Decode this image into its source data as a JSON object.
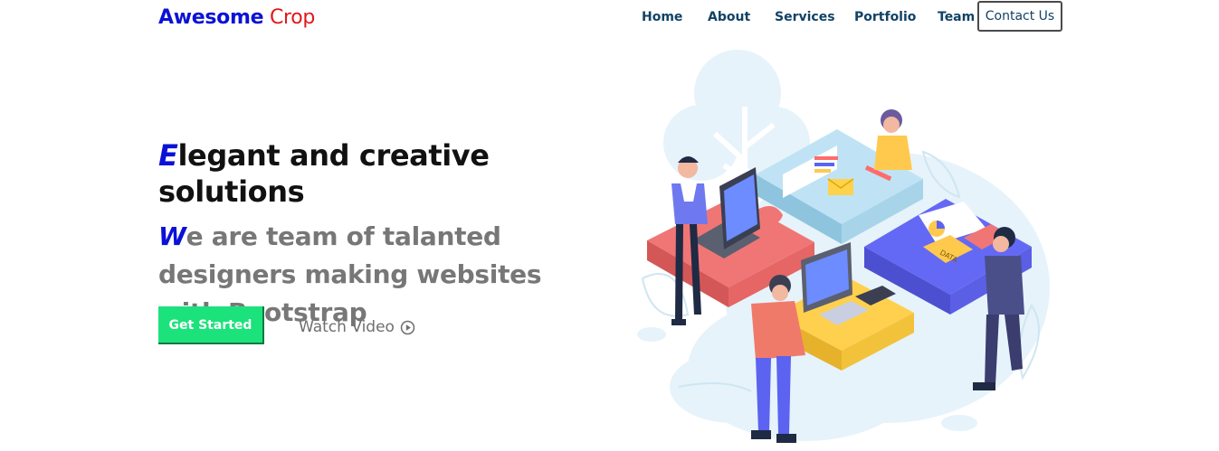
{
  "brand": {
    "part1": "Awesome",
    "part2": "Crop"
  },
  "nav": {
    "items": [
      "Home",
      "About",
      "Services",
      "Portfolio",
      "Team"
    ],
    "contact": "Contact Us"
  },
  "hero": {
    "title_cap": "E",
    "title_rest": "legant and creative solutions",
    "subtitle_cap": "W",
    "subtitle_rest": "e are team of talanted designers making websites with Bootstrap",
    "cta": "Get Started",
    "watch": "Watch Video"
  },
  "illustration": {
    "labels": [
      "DATA",
      "DATA"
    ],
    "icon": "teamwork-puzzle-illustration"
  },
  "colors": {
    "brand_blue": "#0b12d6",
    "brand_red": "#e3171a",
    "nav_text": "#124265",
    "cta_green": "#1ce27b",
    "subtitle_gray": "#777777"
  }
}
